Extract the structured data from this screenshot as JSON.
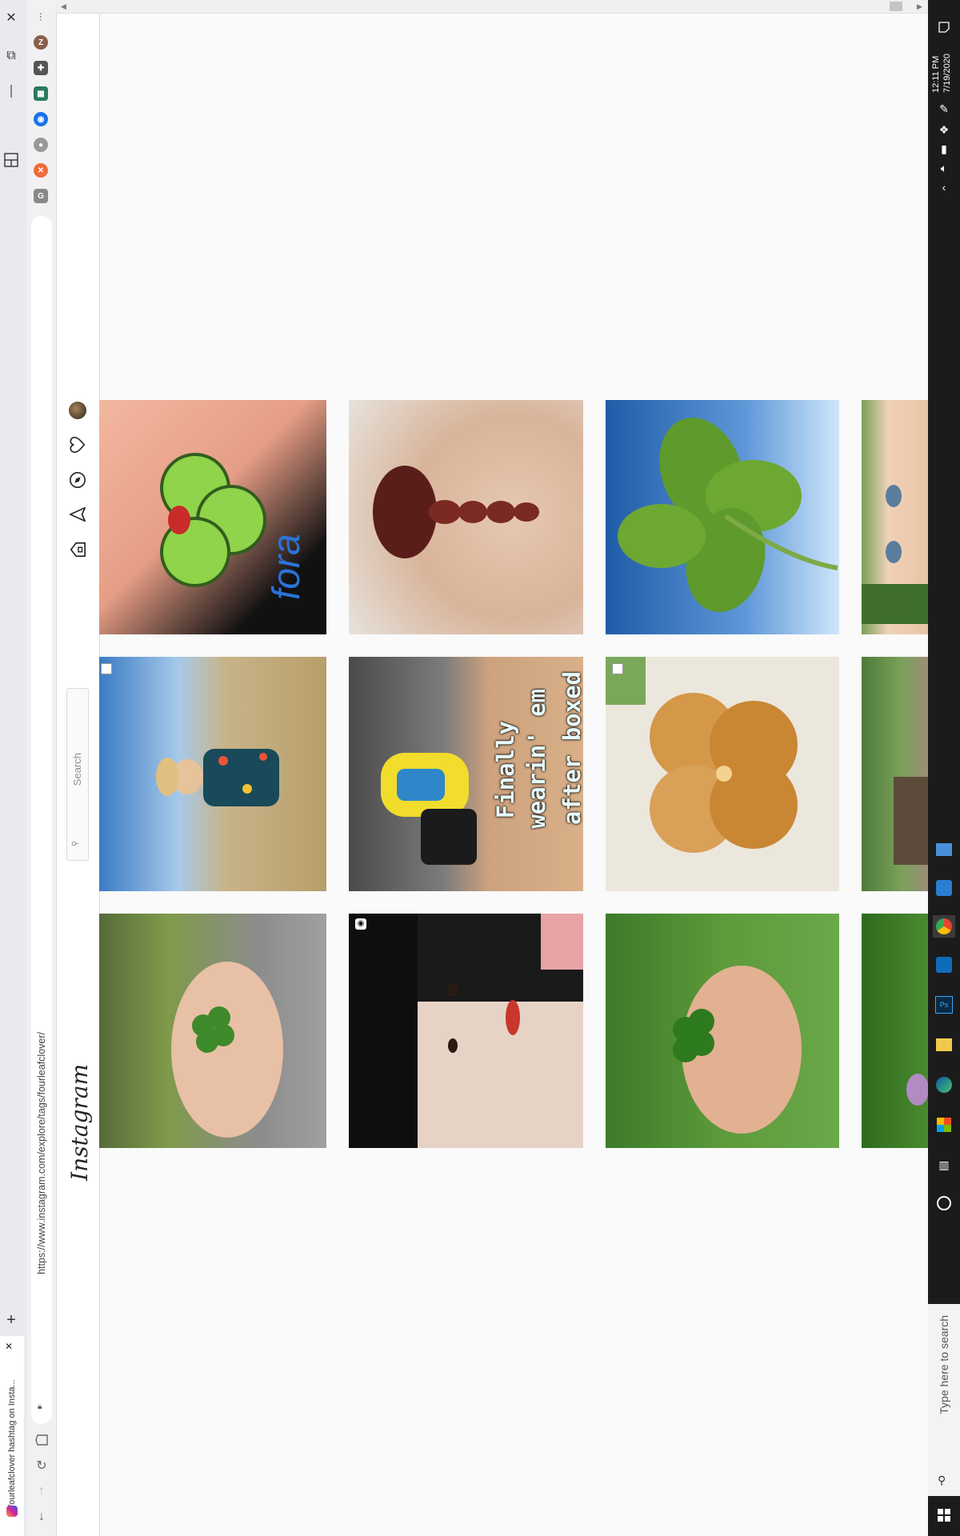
{
  "tab": {
    "title": "#fourleafclover hashtag on Insta...",
    "close_glyph": "✕",
    "new_tab_glyph": "+"
  },
  "browser": {
    "url": "https://www.instagram.com/explore/tags/fourleafclover/",
    "menu_glyph": "···",
    "profile_initial": "Z",
    "window_controls": {
      "close": "✕",
      "restore": "⧉",
      "minimize": "—"
    }
  },
  "instagram": {
    "logo": "Instagram",
    "search": {
      "placeholder": "Search",
      "value": ""
    }
  },
  "posts": [
    {
      "id": "tattoo-hand",
      "description_icon": "clover-tattoo"
    },
    {
      "id": "braided-hair",
      "description_icon": "hair"
    },
    {
      "id": "sky-clover",
      "description_icon": "clover"
    },
    {
      "id": "face-partial",
      "description_icon": "face"
    },
    {
      "id": "girl-beach",
      "description_icon": "child"
    },
    {
      "id": "sneakers-boxed",
      "description_icon": "sneakers",
      "caption_lines": [
        "Finally",
        "wearin' em",
        "after boxed"
      ]
    },
    {
      "id": "gold-clover-dish",
      "description_icon": "gold-clover"
    },
    {
      "id": "house-partial",
      "description_icon": "house"
    },
    {
      "id": "hand-clover-1",
      "description_icon": "clover-hand"
    },
    {
      "id": "selfie-video",
      "description_icon": "video"
    },
    {
      "id": "hand-clover-2",
      "description_icon": "clover-hand"
    },
    {
      "id": "leaves-partial",
      "description_icon": "leaves"
    }
  ],
  "taskbar": {
    "search_placeholder": "Type here to search",
    "time": "12:11 PM",
    "date": "7/19/2020"
  },
  "colors": {
    "ig_background": "#fafafa",
    "taskbar": "#1b1b1b",
    "tabstrip": "#e9eaee"
  }
}
